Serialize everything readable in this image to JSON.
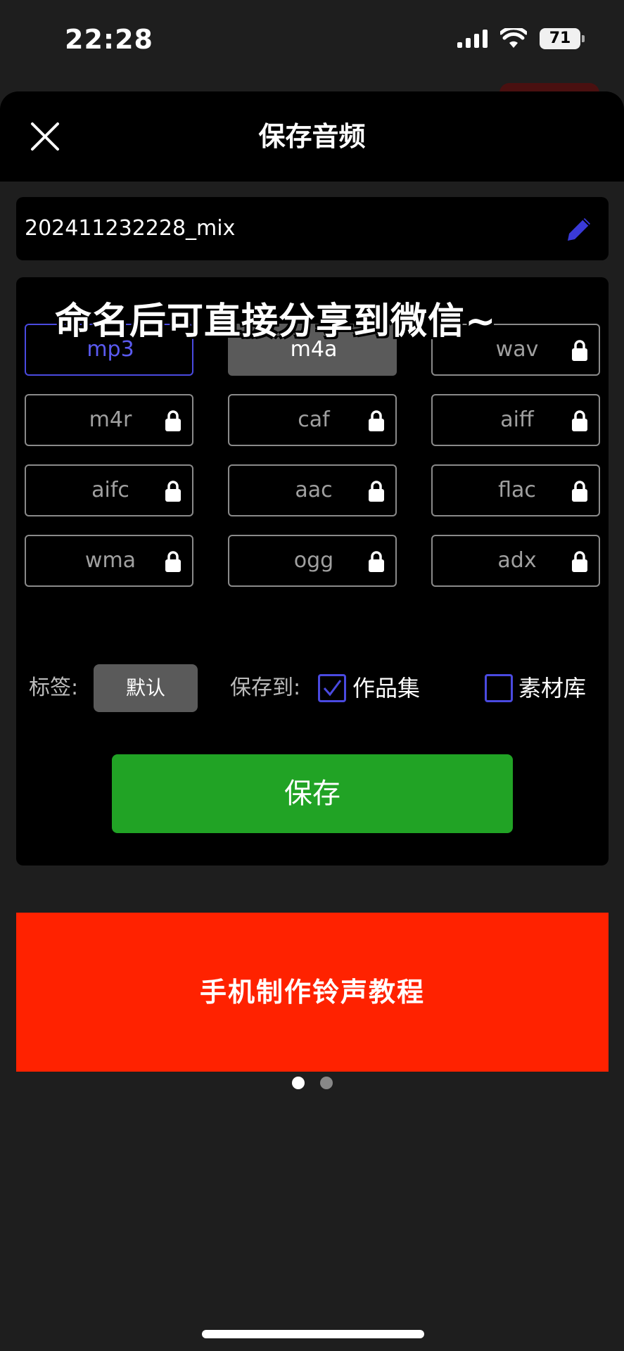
{
  "status_bar": {
    "time": "22:28",
    "battery": "71"
  },
  "header": {
    "title": "保存音频",
    "close_icon": "close-icon"
  },
  "name_field": {
    "value": "202411232228_mix",
    "edit_icon": "pencil-icon"
  },
  "overlay_caption": "命名后可直接分享到微信~",
  "formats": [
    {
      "label": "mp3",
      "state": "selected",
      "locked": false
    },
    {
      "label": "m4a",
      "state": "filled",
      "locked": false
    },
    {
      "label": "wav",
      "state": "normal",
      "locked": true
    },
    {
      "label": "m4r",
      "state": "normal",
      "locked": true
    },
    {
      "label": "caf",
      "state": "normal",
      "locked": true
    },
    {
      "label": "aiff",
      "state": "normal",
      "locked": true
    },
    {
      "label": "aifc",
      "state": "normal",
      "locked": true
    },
    {
      "label": "aac",
      "state": "normal",
      "locked": true
    },
    {
      "label": "flac",
      "state": "normal",
      "locked": true
    },
    {
      "label": "wma",
      "state": "normal",
      "locked": true
    },
    {
      "label": "ogg",
      "state": "normal",
      "locked": true
    },
    {
      "label": "adx",
      "state": "normal",
      "locked": true
    }
  ],
  "options": {
    "tag_label": "标签:",
    "tag_value": "默认",
    "save_to_label": "保存到:",
    "portfolio": {
      "label": "作品集",
      "checked": true
    },
    "library": {
      "label": "素材库",
      "checked": false
    }
  },
  "save_button": "保存",
  "banner": {
    "text": "手机制作铃声教程",
    "pages": 2,
    "current_page": 1
  },
  "colors": {
    "accent": "#4a4ae0",
    "save_green": "#21a325",
    "banner_red": "#ff2200"
  }
}
